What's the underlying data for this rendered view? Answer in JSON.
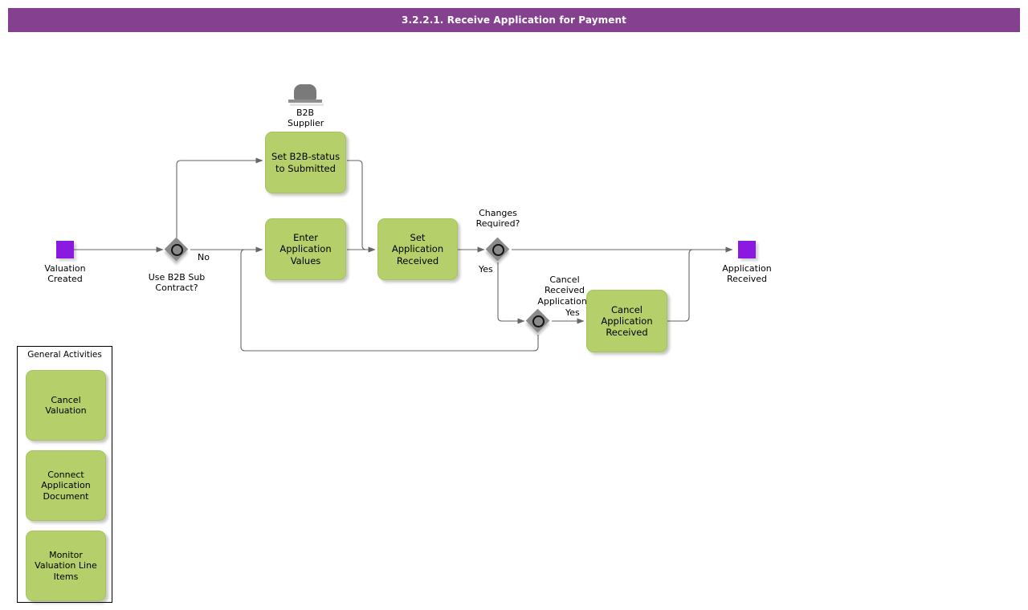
{
  "title_bar": {
    "text": "3.2.2.1. Receive Application for Payment",
    "background": "#85408f",
    "color": "#ffffff"
  },
  "palette": {
    "task_fill": "#b5cf6b",
    "event_fill": "#8b1ae0",
    "gateway_fill": "#8a8a8a",
    "connector": "#666666",
    "canvas": "#ffffff"
  },
  "participant": {
    "icon": "system-participant-icon",
    "label": "B2B\nSupplier"
  },
  "events": {
    "start": {
      "name": "valuation-created",
      "label": "Valuation\nCreated"
    },
    "end": {
      "name": "application-received",
      "label": "Application\nReceived"
    }
  },
  "gateways": [
    {
      "name": "use-b2b-sub-contract",
      "label": "Use B2B Sub\nContract?"
    },
    {
      "name": "changes-required",
      "label": "Changes\nRequired?"
    },
    {
      "name": "cancel-received-application",
      "label": "Cancel\nReceived\nApplication?"
    }
  ],
  "tasks": [
    {
      "name": "set-b2b-status-to-submitted",
      "label": "Set B2B-status\nto Submitted"
    },
    {
      "name": "enter-application-values",
      "label": "Enter Application\nValues"
    },
    {
      "name": "set-application-received",
      "label": "Set Application\nReceived"
    },
    {
      "name": "cancel-application-received",
      "label": "Cancel\nApplication\nReceived"
    }
  ],
  "flow_labels": [
    {
      "name": "flow-label-no-b2b",
      "text": "No"
    },
    {
      "name": "flow-label-yes-changes",
      "text": "Yes"
    },
    {
      "name": "flow-label-yes-cancel",
      "text": "Yes"
    }
  ],
  "general_activities": {
    "title": "General Activities",
    "items": [
      {
        "name": "cancel-valuation",
        "label": "Cancel Valuation"
      },
      {
        "name": "connect-application-document",
        "label": "Connect\nApplication\nDocument"
      },
      {
        "name": "monitor-valuation-line-items",
        "label": "Monitor\nValuation Line\nItems"
      }
    ]
  }
}
